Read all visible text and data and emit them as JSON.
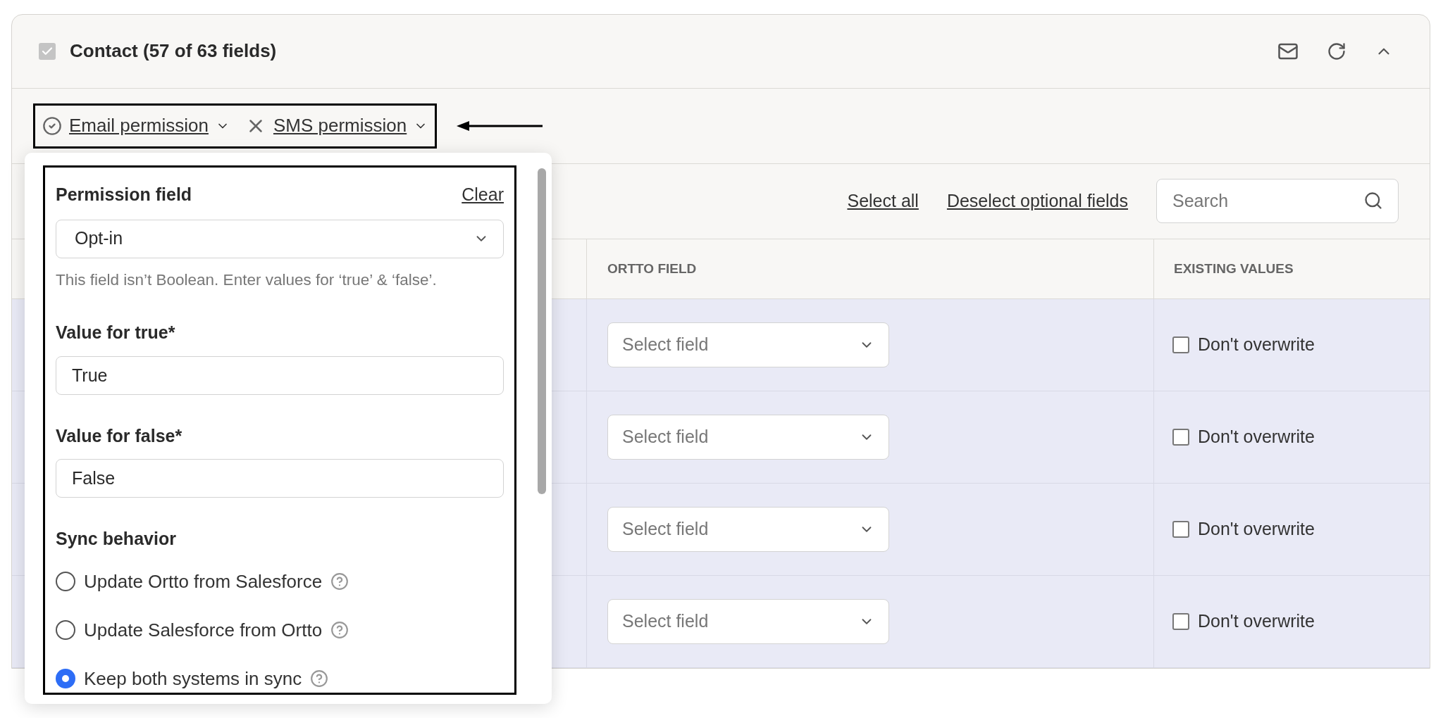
{
  "section": {
    "title": "Contact (57 of 63 fields)",
    "checked": true
  },
  "filters": [
    {
      "label": "Email permission",
      "kind": "set"
    },
    {
      "label": "SMS permission",
      "kind": "unset"
    }
  ],
  "toolbar": {
    "links": [
      "Select all",
      "Deselect optional fields"
    ],
    "search": {
      "placeholder": "Search"
    }
  },
  "table": {
    "columns": [
      "ORTTO FIELD",
      "EXISTING VALUES"
    ],
    "rows": [
      {
        "ortto_field": {
          "placeholder": "Select field"
        },
        "existing": {
          "label": "Don't overwrite",
          "checked": false
        }
      },
      {
        "ortto_field": {
          "placeholder": "Select field"
        },
        "existing": {
          "label": "Don't overwrite",
          "checked": false
        }
      },
      {
        "ortto_field": {
          "placeholder": "Select field"
        },
        "existing": {
          "label": "Don't overwrite",
          "checked": false
        }
      },
      {
        "ortto_field": {
          "placeholder": "Select field"
        },
        "existing": {
          "label": "Don't overwrite",
          "checked": false
        }
      }
    ]
  },
  "popover": {
    "title": "Permission field",
    "clear": "Clear",
    "select_value": "Opt-in",
    "hint": "This field isn’t Boolean. Enter values for ‘true’ & ‘false’.",
    "true_label": "Value for true*",
    "true_value": "True",
    "false_label": "Value for false*",
    "false_value": "False",
    "sync_title": "Sync behavior",
    "options": [
      {
        "label": "Update Ortto from Salesforce",
        "selected": false
      },
      {
        "label": "Update Salesforce from Ortto",
        "selected": false
      },
      {
        "label": "Keep both systems in sync",
        "selected": true
      }
    ]
  }
}
